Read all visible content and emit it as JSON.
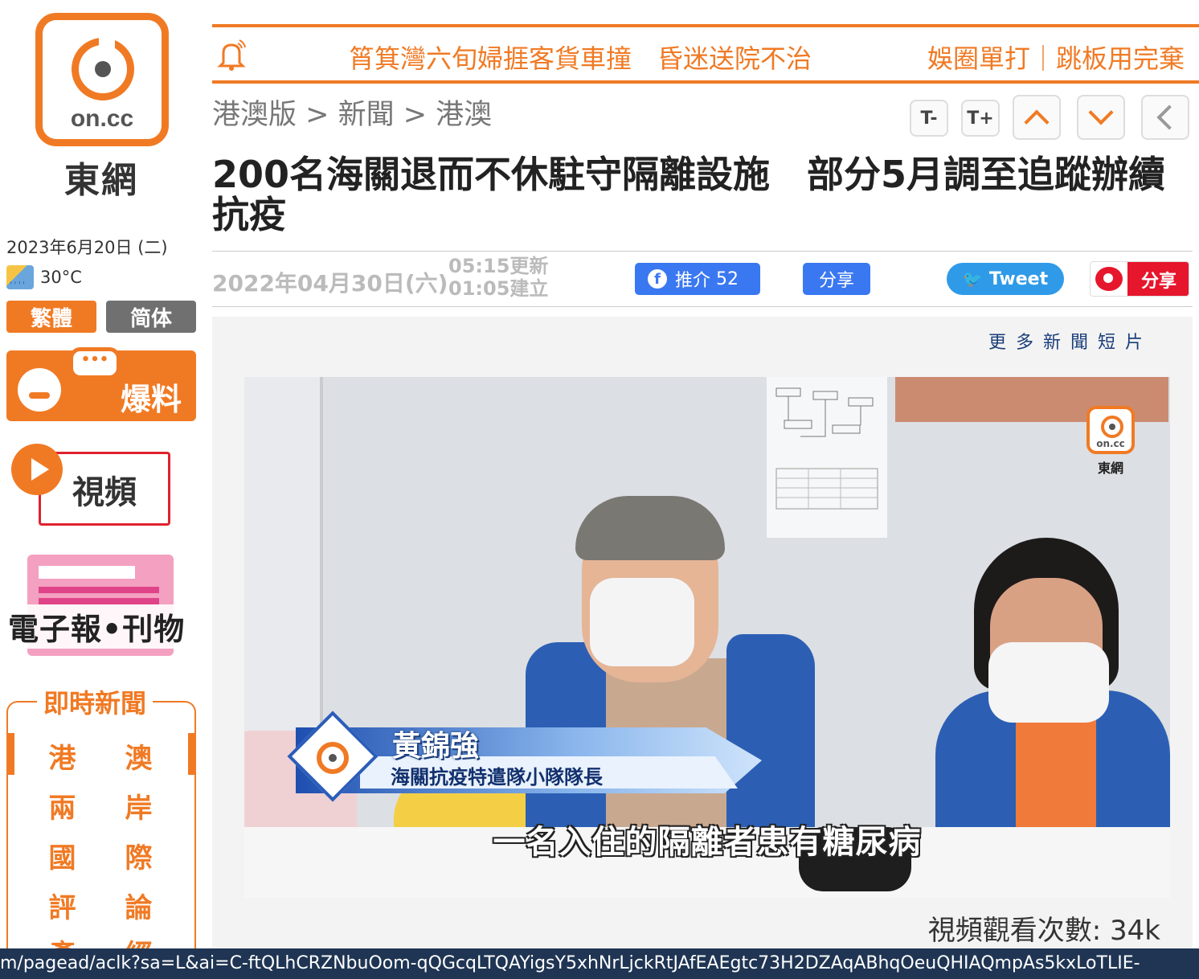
{
  "site": {
    "logo_text": "on.cc",
    "name": "東網"
  },
  "sidebar": {
    "date": "2023年6月20日 (二)",
    "temperature": "30°C",
    "weather_icon": "sun-rain-icon",
    "lang_traditional": "繁體",
    "lang_simplified": "简体",
    "baoliao_label": "爆料",
    "baoliao_bubble": "•••",
    "video_label": "視頻",
    "epaper_label": "電子報•刊物",
    "instant_news_title": "即時新聞",
    "instant_news_items": [
      [
        "港",
        "澳"
      ],
      [
        "兩",
        "岸"
      ],
      [
        "國",
        "際"
      ],
      [
        "評",
        "論"
      ],
      [
        "產",
        "經"
      ]
    ]
  },
  "ticker": {
    "items": [
      "筲箕灣六旬婦捱客貨車撞　昏迷送院不治",
      "娛圈單打｜跳板用完棄"
    ]
  },
  "breadcrumb": {
    "text": "港澳版 > 新聞 > 港澳"
  },
  "tools": {
    "font_smaller": "T-",
    "font_larger": "T+"
  },
  "article": {
    "headline": "200名海關退而不休駐守隔離設施　部分5月調至追蹤辦續抗疫",
    "date": "2022年04月30日(六)",
    "updated": "05:15更新",
    "created": "01:05建立"
  },
  "share": {
    "fb_label": "推介",
    "fb_count": "52",
    "share_label": "分享",
    "tweet_label": "Tweet",
    "weibo_label": "分享"
  },
  "video": {
    "more_clips": "更多新聞短片",
    "watermark_logo": "on.cc",
    "watermark_name": "東網",
    "lower_third_name": "黃錦強",
    "lower_third_title": "海關抗疫特遣隊小隊隊長",
    "subtitle": "一名入住的隔離者患有糖尿病",
    "views_label": "視頻觀看次數:",
    "views_count": "34k"
  },
  "status_bar": {
    "url": "m/pagead/aclk?sa=L&ai=C-ftQLhCRZNbuOom-qQGcqLTQAYigsY5xhNrLjckRtJAfEAEgtc73H2DZAqABhqOeuQHIAQmpAs5kxLoTLIE-"
  },
  "colors": {
    "brand_orange": "#f07a24",
    "facebook_blue": "#3a78f1",
    "twitter_blue": "#2f9ae8",
    "weibo_red": "#e6162d"
  }
}
